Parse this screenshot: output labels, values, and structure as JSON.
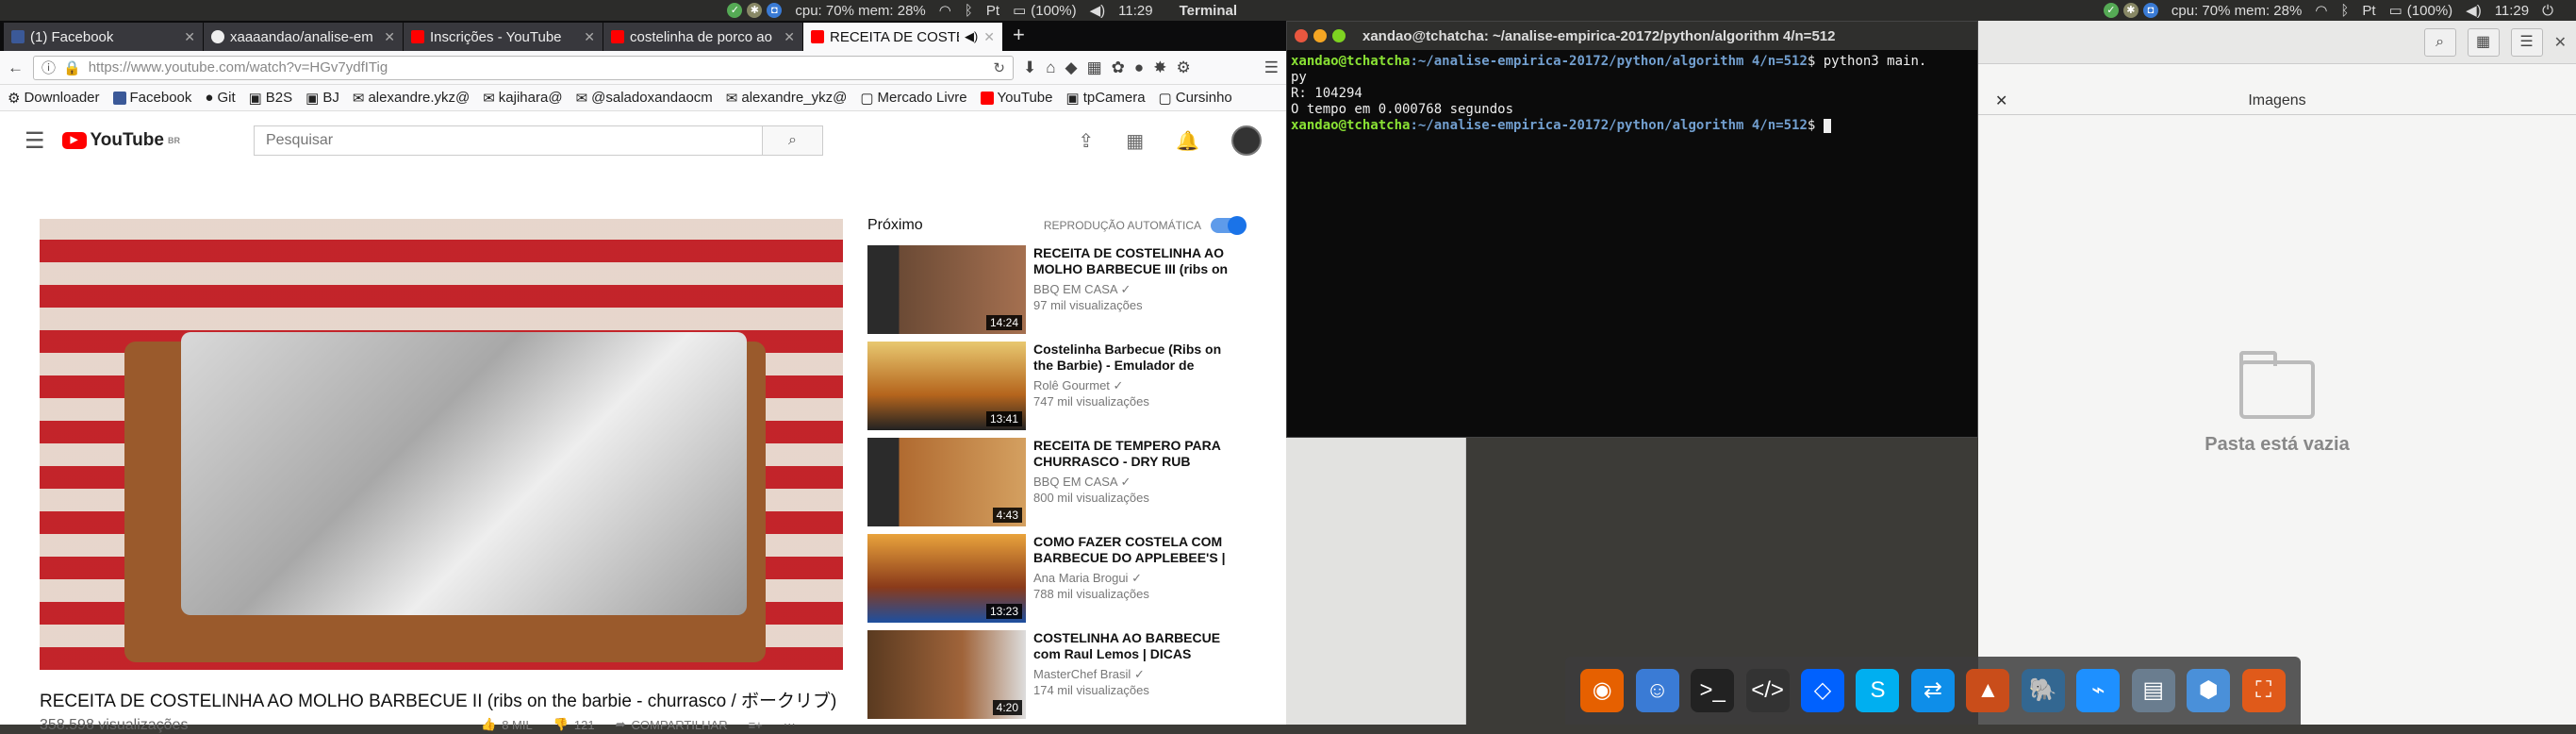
{
  "topbar_left": {
    "cpu": "cpu: 70% mem: 28%",
    "battery": "(100%)",
    "time": "11:29",
    "app": "Terminal"
  },
  "topbar_right": {
    "cpu": "cpu: 70% mem: 28%",
    "battery": "(100%)",
    "time": "11:29"
  },
  "browser": {
    "tabs": [
      {
        "label": "(1) Facebook",
        "color": "#3b5998"
      },
      {
        "label": "xaaaandao/analise-em",
        "color": "#222222"
      },
      {
        "label": "Inscrições - YouTube",
        "color": "#ff0000"
      },
      {
        "label": "costelinha de porco ao",
        "color": "#ff0000"
      },
      {
        "label": "RECEITA DE COSTEL",
        "color": "#ff0000"
      }
    ],
    "url": "https://www.youtube.com/watch?v=HGv7ydfITig",
    "bookmarks": [
      "Downloader",
      "Facebook",
      "Git",
      "B2S",
      "BJ",
      "alexandre.ykz@",
      "kajihara@",
      "@saladoxandaocm",
      "alexandre_ykz@",
      "Mercado Livre",
      "YouTube",
      "tpCamera",
      "Cursinho"
    ]
  },
  "youtube": {
    "logo": "YouTube",
    "logo_sup": "BR",
    "search_placeholder": "Pesquisar",
    "video_title": "RECEITA DE COSTELINHA AO MOLHO BARBECUE II (ribs on the barbie - churrasco / ボークリブ)",
    "views": "358.598 visualizações",
    "likes": "8 MIL",
    "dislikes": "121",
    "share": "COMPARTILHAR",
    "next_label": "Próximo",
    "autoplay_label": "REPRODUÇÃO AUTOMÁTICA",
    "recommendations": [
      {
        "title": "RECEITA DE COSTELINHA AO MOLHO BARBECUE III (ribs on",
        "channel": "BBQ EM CASA",
        "views": "97 mil visualizações",
        "duration": "14:24"
      },
      {
        "title": "Costelinha Barbecue (Ribs on the Barbie) - Emulador de",
        "channel": "Rolê Gourmet",
        "views": "747 mil visualizações",
        "duration": "13:41"
      },
      {
        "title": "RECEITA DE TEMPERO PARA CHURRASCO - DRY RUB",
        "channel": "BBQ EM CASA",
        "views": "800 mil visualizações",
        "duration": "4:43"
      },
      {
        "title": "COMO FAZER COSTELA COM BARBECUE DO APPLEBEE'S |",
        "channel": "Ana Maria Brogui",
        "views": "788 mil visualizações",
        "duration": "13:23"
      },
      {
        "title": "COSTELINHA AO BARBECUE com Raul Lemos | DICAS",
        "channel": "MasterChef Brasil",
        "views": "174 mil visualizações",
        "duration": "4:20"
      }
    ]
  },
  "terminal": {
    "title": "xandao@tchatcha: ~/analise-empirica-20172/python/algorithm 4/n=512",
    "user": "xandao@tchatcha",
    "path": ":~/analise-empirica-20172/python/algorithm 4/n=512",
    "cmd": "$ python3 main.",
    "cmd_wrap": "py",
    "out1": "R: 104294",
    "out2": "O tempo em 0.000768 segundos",
    "prompt_end": "$ "
  },
  "files": {
    "tab_label": "Imagens",
    "empty_text": "Pasta está vazia"
  }
}
